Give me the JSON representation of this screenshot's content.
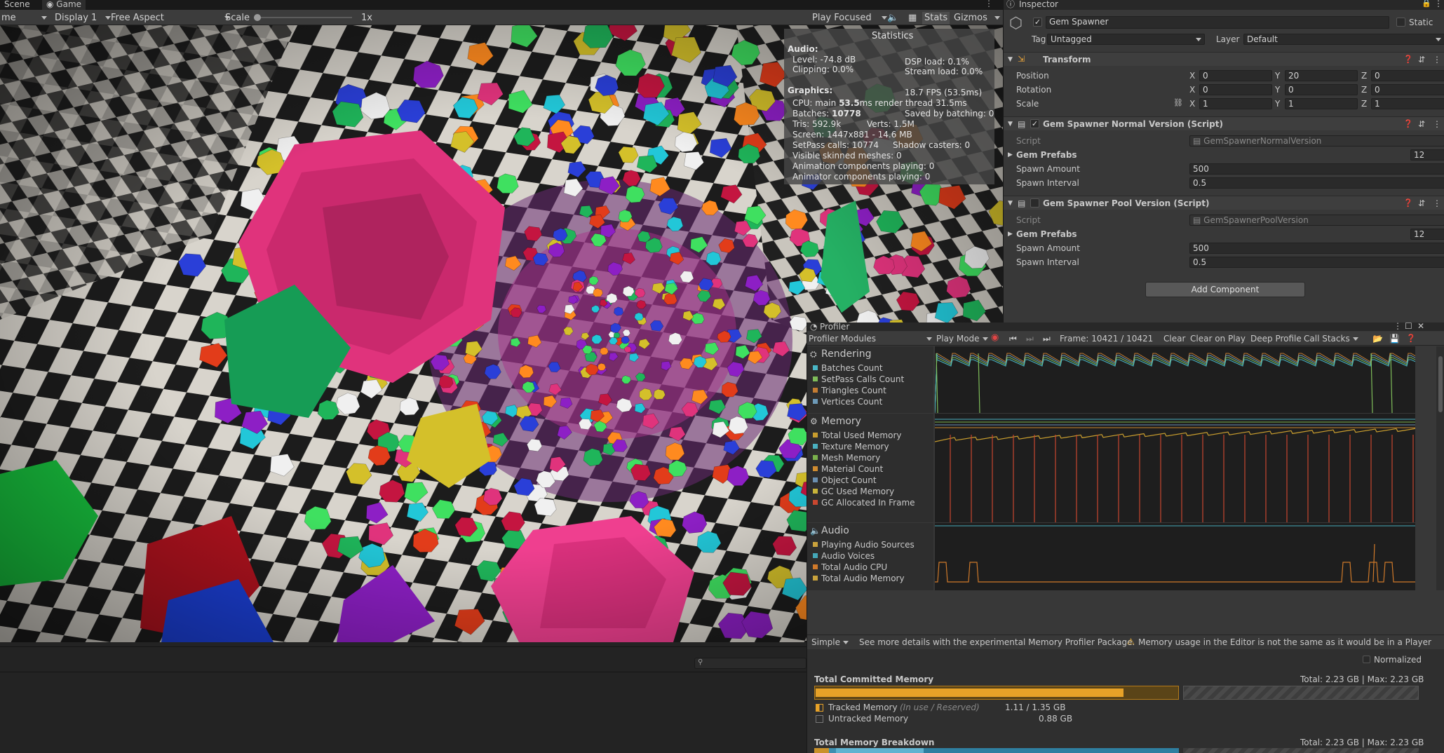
{
  "tabs": {
    "scene": "Scene",
    "game": "Game"
  },
  "game_toolbar": {
    "mode": "me",
    "display": "Display 1",
    "aspect": "Free Aspect",
    "scale_label": "Scale",
    "scale_value": "1x",
    "play_focused": "Play Focused",
    "stats": "Stats",
    "gizmos": "Gizmos"
  },
  "statistics": {
    "title": "Statistics",
    "audio_header": "Audio:",
    "level": "Level: -74.8 dB",
    "clipping": "Clipping: 0.0%",
    "dsp_load": "DSP load: 0.1%",
    "stream_load": "Stream load: 0.0%",
    "graphics_header": "Graphics:",
    "fps": "18.7 FPS (53.5ms)",
    "cpu_prefix": "CPU: main ",
    "cpu_main": "53.5",
    "cpu_suffix": "ms  render thread 31.5ms",
    "batches_prefix": "Batches: ",
    "batches": "10778",
    "saved_batching": "Saved by batching: 0",
    "tris": "Tris: 592.9k",
    "verts": "Verts: 1.5M",
    "screen": "Screen: 1447x881 - 14.6 MB",
    "setpass": "SetPass calls: 10774",
    "shadow_casters": "Shadow casters: 0",
    "skinned": "Visible skinned meshes: 0",
    "animation": "Animation components playing: 0",
    "animator": "Animator components playing: 0"
  },
  "inspector": {
    "tab": "Inspector",
    "object_name": "Gem Spawner",
    "static_label": "Static",
    "tag_label": "Tag",
    "tag_value": "Untagged",
    "layer_label": "Layer",
    "layer_value": "Default",
    "transform": {
      "title": "Transform",
      "position_label": "Position",
      "rotation_label": "Rotation",
      "scale_label": "Scale",
      "position": [
        "0",
        "20",
        "0"
      ],
      "rotation": [
        "0",
        "0",
        "0"
      ],
      "scale": [
        "1",
        "1",
        "1"
      ],
      "axis_x": "X",
      "axis_y": "Y",
      "axis_z": "Z"
    },
    "normal_script": {
      "title": "Gem Spawner Normal Version (Script)",
      "script_label": "Script",
      "script_value": "GemSpawnerNormalVersion",
      "prefabs_label": "Gem Prefabs",
      "prefabs_count": "12",
      "amount_label": "Spawn Amount",
      "amount_value": "500",
      "interval_label": "Spawn Interval",
      "interval_value": "0.5"
    },
    "pool_script": {
      "title": "Gem Spawner Pool Version (Script)",
      "script_label": "Script",
      "script_value": "GemSpawnerPoolVersion",
      "prefabs_label": "Gem Prefabs",
      "prefabs_count": "12",
      "amount_label": "Spawn Amount",
      "amount_value": "500",
      "interval_label": "Spawn Interval",
      "interval_value": "0.5"
    },
    "add_component": "Add Component"
  },
  "profiler": {
    "tab": "Profiler",
    "modules_label": "Profiler Modules",
    "play_mode": "Play Mode",
    "frame": "Frame: 10421 / 10421",
    "clear": "Clear",
    "clear_on_play": "Clear on Play",
    "deep_profile": "Deep Profile",
    "call_stacks": "Call Stacks",
    "rendering": {
      "title": "Rendering",
      "items": [
        "Batches Count",
        "SetPass Calls Count",
        "Triangles Count",
        "Vertices Count"
      ]
    },
    "memory": {
      "title": "Memory",
      "items": [
        "Total Used Memory",
        "Texture Memory",
        "Mesh Memory",
        "Material Count",
        "Object Count",
        "GC Used Memory",
        "GC Allocated In Frame"
      ]
    },
    "audio": {
      "title": "Audio",
      "items": [
        "Playing Audio Sources",
        "Audio Voices",
        "Total Audio CPU",
        "Total Audio Memory"
      ]
    },
    "simple": "Simple",
    "note1": "See more details with the experimental Memory Profiler Package.",
    "note2": "Memory usage in the Editor is not the same as it would be in a Player",
    "normalized": "Normalized",
    "total_committed": "Total Committed Memory",
    "total_committed_value": "Total: 2.23 GB | Max: 2.23 GB",
    "tracked_label": "Tracked Memory",
    "tracked_hint": "(In use / Reserved)",
    "tracked_value": "1.11 / 1.35 GB",
    "untracked_label": "Untracked Memory",
    "untracked_value": "0.88 GB",
    "breakdown": "Total Memory Breakdown",
    "breakdown_value": "Total: 2.23 GB | Max: 2.23 GB",
    "committed_fill": 0.85
  },
  "colors": {
    "batches": "#49b6c6",
    "setpass": "#7fbd5a",
    "triangles": "#c47c32",
    "vertices": "#6d9ab8",
    "total_used": "#c89d2e",
    "texture": "#4ab0c0",
    "mesh": "#7ab04c",
    "material": "#d08c30",
    "object": "#6a8fb0",
    "gc_used": "#c8b43a",
    "gc_alloc": "#c9472f",
    "audio_sources": "#c9a23c",
    "audio_voices": "#44a8b8",
    "audio_cpu": "#d07a2a",
    "audio_memory": "#c9a23c"
  }
}
